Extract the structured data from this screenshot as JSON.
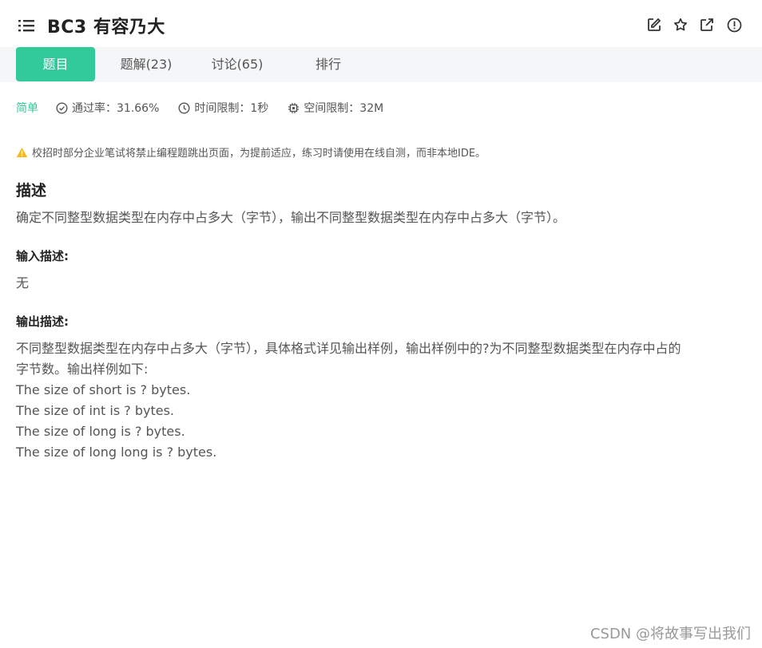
{
  "header": {
    "title": "BC3  有容乃大",
    "icons": [
      "list-icon",
      "edit-icon",
      "star-icon",
      "share-icon",
      "report-icon"
    ]
  },
  "tabs": [
    {
      "label": "题目"
    },
    {
      "label": "题解(23)"
    },
    {
      "label": "讨论(65)"
    },
    {
      "label": "排行"
    }
  ],
  "meta": {
    "difficulty": "简单",
    "pass_rate": "通过率：31.66%",
    "time_limit": "时间限制：1秒",
    "space_limit": "空间限制：32M"
  },
  "warning": "校招时部分企业笔试将禁止编程题跳出页面，为提前适应，练习时请使用在线自测，而非本地IDE。",
  "description": {
    "heading": "描述",
    "text": "确定不同整型数据类型在内存中占多大（字节），输出不同整型数据类型在内存中占多大（字节）。"
  },
  "input": {
    "heading": "输入描述:",
    "text": "无"
  },
  "output": {
    "heading": "输出描述:",
    "line1": "不同整型数据类型在内存中占多大（字节），具体格式详见输出样例，输出样例中的?为不同整型数据类型在内存中占的",
    "line2": "字节数。输出样例如下:",
    "samples": [
      "The size of short is ? bytes.",
      "The size of int is ? bytes.",
      "The size of long is ? bytes.",
      "The size of long long is ? bytes."
    ]
  },
  "watermark": "CSDN @将故事写出我们",
  "colors": {
    "accent": "#32ca99",
    "warning": "#f5b91c",
    "tab_bg": "#f5f6f8"
  }
}
